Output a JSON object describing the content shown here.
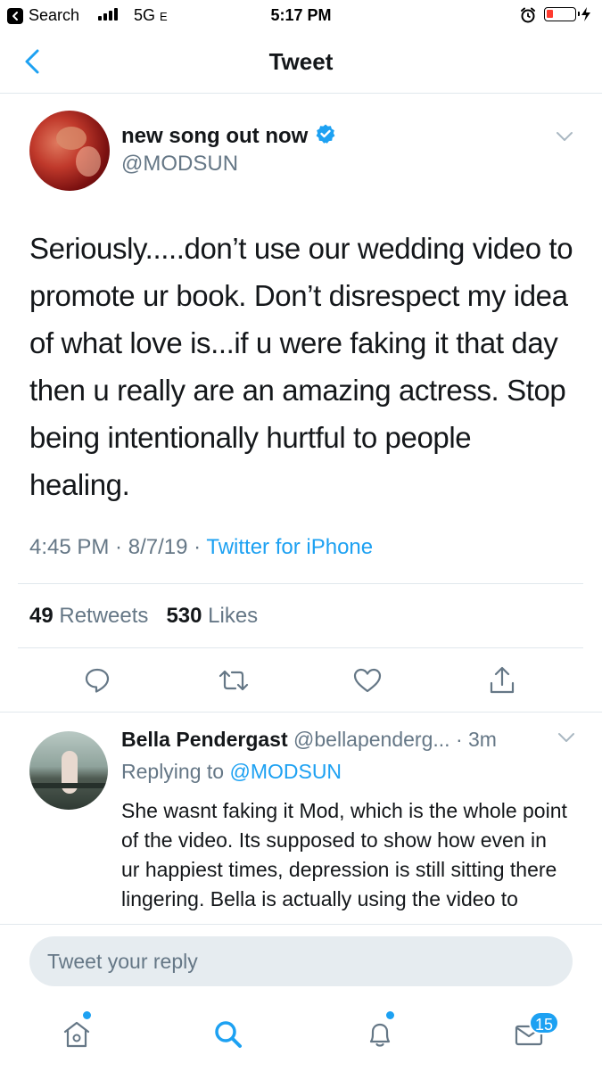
{
  "status_bar": {
    "back_app": "Search",
    "network": "5G",
    "network_suffix": "E",
    "time": "5:17 PM"
  },
  "nav": {
    "title": "Tweet"
  },
  "tweet": {
    "display_name": "new song out now",
    "handle": "@MODSUN",
    "verified": true,
    "text": "Seriously.....don’t use our wedding video to promote ur book. Don’t disrespect my idea of what love is...if u were faking it that day then u really are an amazing actress. Stop being intentionally hurtful to people healing.",
    "time": "4:45 PM",
    "date": "8/7/19",
    "source": "Twitter for iPhone",
    "retweets_count": "49",
    "retweets_label": "Retweets",
    "likes_count": "530",
    "likes_label": "Likes"
  },
  "reply": {
    "display_name": "Bella Pendergast",
    "handle": "@bellapenderg...",
    "age": "3m",
    "replying_prefix": "Replying to",
    "replying_to": "@MODSUN",
    "text": "She wasnt faking it Mod, which is the whole point of the video. Its supposed to show how even in ur happiest times, depression is still sitting there lingering. Bella is actually using the video to"
  },
  "compose": {
    "placeholder": "Tweet your reply"
  },
  "tab_bar": {
    "messages_badge": "15"
  },
  "colors": {
    "accent": "#1da1f2",
    "muted": "#657786",
    "text": "#14171a",
    "battery_low": "#ff3b30"
  },
  "icons": {
    "status": [
      "back-arrow-icon",
      "signal-icon",
      "alarm-icon",
      "battery-icon",
      "charging-bolt-icon"
    ],
    "actions": [
      "reply-icon",
      "retweet-icon",
      "like-icon",
      "share-icon"
    ],
    "tabs": [
      "home-icon",
      "search-icon",
      "notifications-icon",
      "messages-icon"
    ]
  }
}
